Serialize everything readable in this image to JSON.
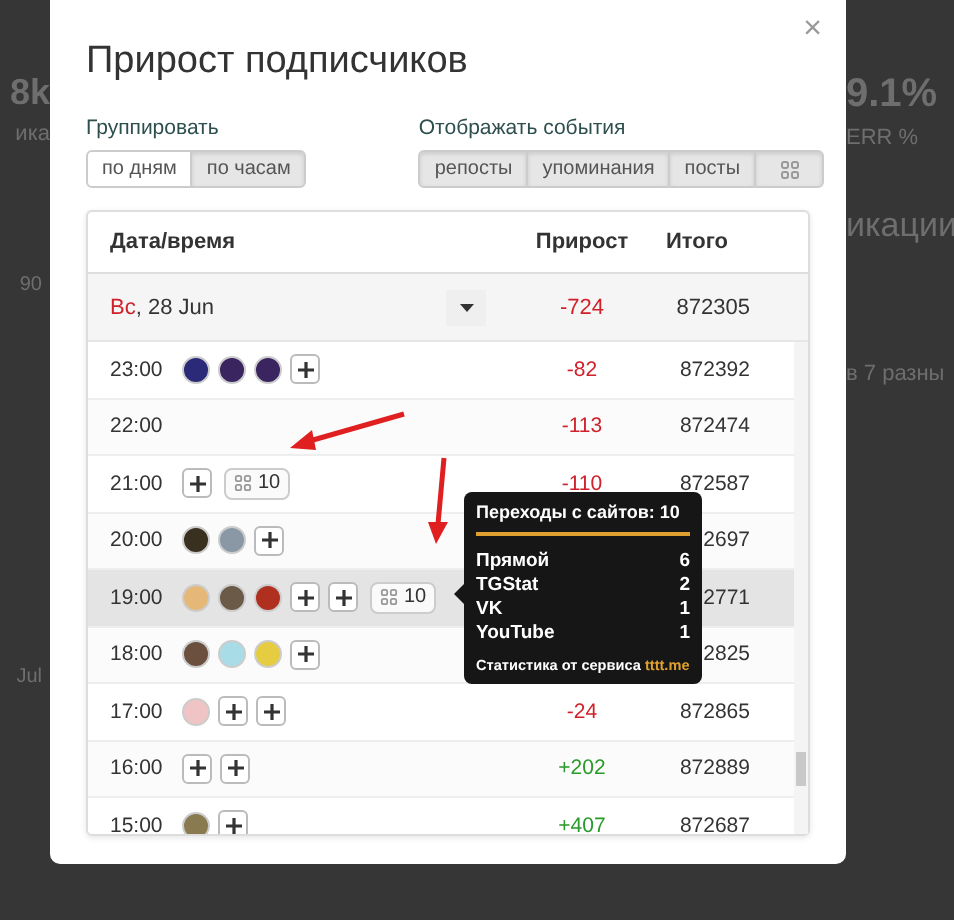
{
  "background": {
    "left": [
      {
        "text": "8k",
        "kind": "big"
      },
      {
        "text": "ика",
        "kind": "small"
      },
      {
        "text": "90",
        "kind": "axis"
      },
      {
        "text": "Jul",
        "kind": "axis"
      }
    ],
    "right": [
      {
        "text": "9.1%",
        "kind": "big"
      },
      {
        "text": "ERR %",
        "kind": "small"
      },
      {
        "text": "икации",
        "kind": "heading"
      },
      {
        "text": "в 7 разны",
        "kind": "small"
      }
    ]
  },
  "modal": {
    "title": "Прирост подписчиков",
    "close": "×"
  },
  "grouping": {
    "label": "Группировать",
    "options": [
      {
        "label": "по дням",
        "selected": false
      },
      {
        "label": "по часам",
        "selected": true
      }
    ]
  },
  "events": {
    "label": "Отображать события",
    "options": [
      {
        "kind": "text",
        "label": "репосты",
        "selected": true
      },
      {
        "kind": "text",
        "label": "упоминания",
        "selected": true
      },
      {
        "kind": "text",
        "label": "посты",
        "selected": true
      },
      {
        "kind": "icon",
        "selected": true
      }
    ]
  },
  "table": {
    "columns": [
      "Дата/время",
      "Прирост",
      "Итого"
    ],
    "day": {
      "weekday": "Вс",
      "date": ", 28 Jun",
      "growth": "-724",
      "color": "#d0202a",
      "total": "872305"
    },
    "rows": [
      {
        "time": "23:00",
        "items": [
          {
            "kind": "avatar",
            "color": "#2b2a78"
          },
          {
            "kind": "avatar",
            "color": "#3a2560"
          },
          {
            "kind": "avatar",
            "color": "#3a2560"
          },
          {
            "kind": "plus"
          }
        ],
        "growth": "-82",
        "color": "#d0202a",
        "total": "872392",
        "highlighted": false
      },
      {
        "time": "22:00",
        "items": [],
        "growth": "-113",
        "color": "#d0202a",
        "total": "872474",
        "highlighted": false
      },
      {
        "time": "21:00",
        "items": [
          {
            "kind": "plus"
          },
          {
            "kind": "links",
            "count": "10"
          }
        ],
        "growth": "-110",
        "color": "#d0202a",
        "total": "872587",
        "highlighted": false
      },
      {
        "time": "20:00",
        "items": [
          {
            "kind": "avatar",
            "color": "#3a3020"
          },
          {
            "kind": "avatar",
            "color": "#8a98a6"
          },
          {
            "kind": "plus"
          }
        ],
        "total": "2697",
        "highlighted": false
      },
      {
        "time": "19:00",
        "items": [
          {
            "kind": "avatar",
            "color": "#e6b878"
          },
          {
            "kind": "avatar",
            "color": "#6b5a48"
          },
          {
            "kind": "avatar",
            "color": "#b03020"
          },
          {
            "kind": "plus"
          },
          {
            "kind": "plus"
          },
          {
            "kind": "links",
            "count": "10"
          }
        ],
        "total": "2771",
        "highlighted": true
      },
      {
        "time": "18:00",
        "items": [
          {
            "kind": "avatar",
            "color": "#6b5040"
          },
          {
            "kind": "avatar",
            "color": "#a8dce6"
          },
          {
            "kind": "avatar",
            "color": "#e6cc40"
          },
          {
            "kind": "plus"
          }
        ],
        "total": "2825",
        "highlighted": false
      },
      {
        "time": "17:00",
        "items": [
          {
            "kind": "avatar",
            "color": "#f0c4c4"
          },
          {
            "kind": "plus"
          },
          {
            "kind": "plus"
          }
        ],
        "growth": "-24",
        "color": "#d0202a",
        "total": "872865",
        "highlighted": false
      },
      {
        "time": "16:00",
        "items": [
          {
            "kind": "plus"
          },
          {
            "kind": "plus"
          }
        ],
        "growth": "+202",
        "color": "#2a9a2a",
        "total": "872889",
        "highlighted": false
      },
      {
        "time": "15:00",
        "items": [
          {
            "kind": "avatar",
            "color": "#8a7a50"
          },
          {
            "kind": "plus"
          }
        ],
        "growth": "+407",
        "color": "#2a9a2a",
        "total": "872687",
        "highlighted": false
      }
    ]
  },
  "tooltip": {
    "title": "Переходы с сайтов: 10",
    "rows": [
      {
        "source": "Прямой",
        "count": "6"
      },
      {
        "source": "TGStat",
        "count": "2"
      },
      {
        "source": "VK",
        "count": "1"
      },
      {
        "source": "YouTube",
        "count": "1"
      }
    ],
    "footer": "Статистика от сервиса",
    "link": "tttt.me"
  }
}
